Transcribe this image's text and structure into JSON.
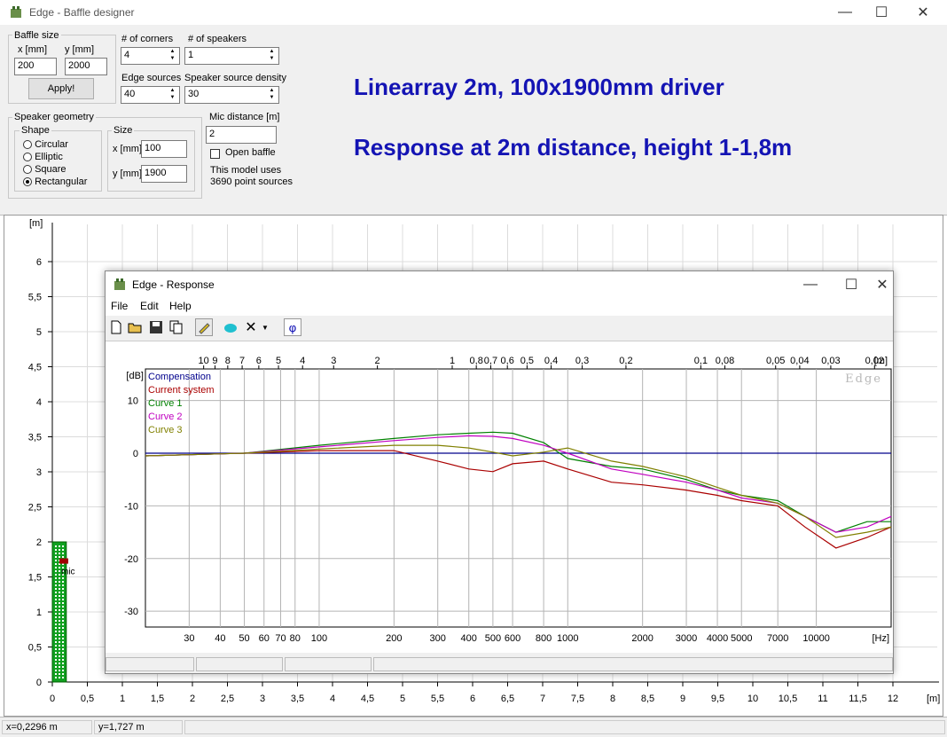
{
  "main": {
    "title": "Edge - Baffle designer",
    "controls": {
      "baffle_size": {
        "legend": "Baffle size",
        "x_label": "x [mm]",
        "y_label": "y [mm]",
        "x_value": "200",
        "y_value": "2000",
        "apply_label": "Apply!"
      },
      "corners": {
        "label": "# of corners",
        "value": "4"
      },
      "speakers": {
        "label": "# of speakers",
        "value": "1"
      },
      "edge_sources": {
        "label": "Edge sources",
        "value": "40"
      },
      "source_density": {
        "label": "Speaker source density",
        "value": "30"
      },
      "mic_distance": {
        "label": "Mic distance [m]",
        "value": "2"
      },
      "open_baffle": {
        "label": "Open baffle",
        "checked": false
      },
      "model_info": [
        "This model uses",
        "3690 point sources"
      ],
      "speaker_geometry": {
        "legend": "Speaker geometry",
        "shape_legend": "Shape",
        "shapes": [
          "Circular",
          "Elliptic",
          "Square",
          "Rectangular"
        ],
        "selected_shape": "Rectangular",
        "size_legend": "Size",
        "x_label": "x [mm]",
        "x_value": "100",
        "y_label": "y [mm]",
        "y_value": "1900"
      }
    },
    "annotation": {
      "line1": "Linearray 2m,  100x1900mm  driver",
      "line2": "Response at 2m distance, height 1-1,8m"
    },
    "baffle_plot": {
      "unit_y": "[m]",
      "unit_x": "[m]",
      "y_ticks": [
        "0",
        "0,5",
        "1",
        "1,5",
        "2",
        "2,5",
        "3",
        "3,5",
        "4",
        "4,5",
        "5",
        "5,5",
        "6"
      ],
      "x_ticks": [
        "0",
        "0,5",
        "1",
        "1,5",
        "2",
        "2,5",
        "3",
        "3,5",
        "4",
        "4,5",
        "5",
        "5,5",
        "6",
        "6,5",
        "7",
        "7,5",
        "8",
        "8,5",
        "9",
        "9,5",
        "10",
        "10,5",
        "11",
        "11,5",
        "12"
      ],
      "mic_label": "mic",
      "baffle_width_m": 0.2,
      "baffle_height_m": 2.0,
      "mic_height_m": 1.727
    },
    "status": {
      "x": "x=0,2296 m",
      "y": "y=1,727 m"
    }
  },
  "response": {
    "title": "Edge - Response",
    "menu": [
      "File",
      "Edit",
      "Help"
    ],
    "tool_icons": [
      "new-icon",
      "open-icon",
      "save-icon",
      "copy-icon",
      "pen-icon",
      "teapot-icon",
      "delete-icon",
      "dropdown-arrow-icon",
      "phase-icon"
    ],
    "phase_glyph": "φ",
    "watermark": "Edge",
    "colors": {
      "compensation": "#00008c",
      "current": "#aa0000",
      "curve1": "#008000",
      "curve2": "#c000c0",
      "curve3": "#808000"
    }
  },
  "chart_data": {
    "type": "line",
    "ylabel": "[dB]",
    "xlabel": "[Hz]",
    "x_scale": "log",
    "xlim": [
      20,
      20000
    ],
    "ylim": [
      -33,
      16
    ],
    "y_ticks": [
      "10",
      "0",
      "-10",
      "-20",
      "-30"
    ],
    "x_ticks": [
      "30",
      "40",
      "50",
      "60",
      "70",
      "80",
      "100",
      "200",
      "300",
      "400",
      "500",
      "600",
      "800",
      "1000",
      "2000",
      "3000",
      "4000",
      "5000",
      "7000",
      "10000"
    ],
    "top_axis_label": "[m]",
    "top_ticks": [
      "10",
      "9",
      "8",
      "7",
      "6",
      "5",
      "4",
      "3",
      "2",
      "1",
      "0,8",
      "0,7",
      "0,6",
      "0,5",
      "0,4",
      "0,3",
      "0,2",
      "0,1",
      "0,08",
      "0,05",
      "0,04",
      "0,03",
      "0,02"
    ],
    "top_tick_values_m": [
      10,
      9,
      8,
      7,
      6,
      5,
      4,
      3,
      2,
      1,
      0.8,
      0.7,
      0.6,
      0.5,
      0.4,
      0.3,
      0.2,
      0.1,
      0.08,
      0.05,
      0.04,
      0.03,
      0.02
    ],
    "series": [
      {
        "name": "Compensation",
        "x": [
          20,
          20000
        ],
        "y": [
          0,
          0
        ]
      },
      {
        "name": "Current system",
        "x": [
          20,
          50,
          100,
          200,
          300,
          400,
          500,
          600,
          800,
          1000,
          1500,
          2000,
          3000,
          4000,
          5000,
          7000,
          9000,
          12000,
          16000,
          20000
        ],
        "y": [
          -0.5,
          0,
          0.5,
          0.5,
          -1.5,
          -3,
          -3.5,
          -2,
          -1.5,
          -3,
          -5.5,
          -6,
          -7,
          -8,
          -9,
          -10,
          -14,
          -18,
          -16,
          -14
        ]
      },
      {
        "name": "Curve 1",
        "x": [
          20,
          50,
          100,
          200,
          300,
          400,
          500,
          600,
          800,
          1000,
          1500,
          2000,
          3000,
          4000,
          5000,
          7000,
          9000,
          12000,
          16000,
          20000
        ],
        "y": [
          -0.5,
          0,
          1.5,
          2.8,
          3.5,
          3.8,
          4,
          3.8,
          2,
          -1,
          -2.5,
          -3,
          -5,
          -7,
          -8,
          -9,
          -12,
          -15,
          -13,
          -13
        ]
      },
      {
        "name": "Curve 2",
        "x": [
          20,
          50,
          100,
          200,
          300,
          400,
          500,
          600,
          800,
          1000,
          1500,
          2000,
          3000,
          4000,
          5000,
          7000,
          9000,
          12000,
          16000,
          20000
        ],
        "y": [
          -0.5,
          0,
          1.2,
          2.4,
          3,
          3.3,
          3.2,
          2.8,
          1.5,
          0,
          -3,
          -4,
          -5.5,
          -7,
          -8.5,
          -9.5,
          -12,
          -15,
          -14,
          -12
        ]
      },
      {
        "name": "Curve 3",
        "x": [
          20,
          50,
          100,
          200,
          300,
          400,
          500,
          600,
          800,
          1000,
          1500,
          2000,
          3000,
          4000,
          5000,
          7000,
          9000,
          12000,
          16000,
          20000
        ],
        "y": [
          -0.5,
          0,
          0.8,
          1.5,
          1.5,
          1,
          0.2,
          -0.5,
          0.2,
          1,
          -1.5,
          -2.5,
          -4.5,
          -6.5,
          -8,
          -9.5,
          -12,
          -16,
          -15,
          -14
        ]
      }
    ]
  }
}
